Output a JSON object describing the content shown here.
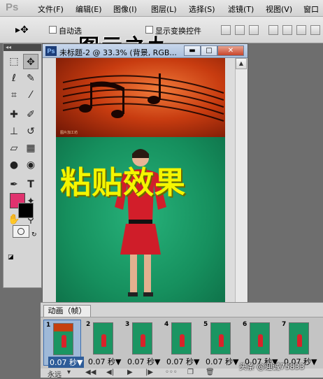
{
  "app": {
    "logo": "Ps",
    "menu": [
      "文件(F)",
      "编辑(E)",
      "图像(I)",
      "图层(L)",
      "选择(S)",
      "滤镜(T)",
      "视图(V)",
      "窗口"
    ]
  },
  "options_bar": {
    "auto_select_label": "自动选",
    "show_transform_label": "显示变换控件",
    "overlay_title": "图示之九"
  },
  "document": {
    "ps_badge": "Ps",
    "title": "未标题-2 @ 33.3% (背景, RGB...",
    "paste_text": "粘贴效果",
    "image_caption": "图片加工坊",
    "canvas_colors": {
      "top": "#c83c10",
      "bottom": "#1d9a66"
    }
  },
  "tools": {
    "foreground_color": "#e0326e",
    "background_color": "#000000",
    "icons": [
      "marquee-icon",
      "move-icon",
      "lasso-icon",
      "quick-select-icon",
      "crop-icon",
      "eyedropper-icon",
      "healing-icon",
      "brush-icon",
      "stamp-icon",
      "history-brush-icon",
      "eraser-icon",
      "gradient-icon",
      "blur-icon",
      "dodge-icon",
      "pen-icon",
      "type-icon",
      "path-select-icon",
      "shape-icon",
      "hand-icon",
      "zoom-icon"
    ]
  },
  "animation": {
    "tab_label": "动画（帧）",
    "frames": [
      {
        "num": "1",
        "delay": "0.07 秒▼"
      },
      {
        "num": "2",
        "delay": "0.07 秒▼"
      },
      {
        "num": "3",
        "delay": "0.07 秒▼"
      },
      {
        "num": "4",
        "delay": "0.07 秒▼"
      },
      {
        "num": "5",
        "delay": "0.07 秒▼"
      },
      {
        "num": "6",
        "delay": "0.07 秒▼"
      },
      {
        "num": "7",
        "delay": "0.07 秒▼"
      }
    ],
    "loop": "永远",
    "selected_frame": 1
  },
  "watermark": "头条 @迎诚75833"
}
